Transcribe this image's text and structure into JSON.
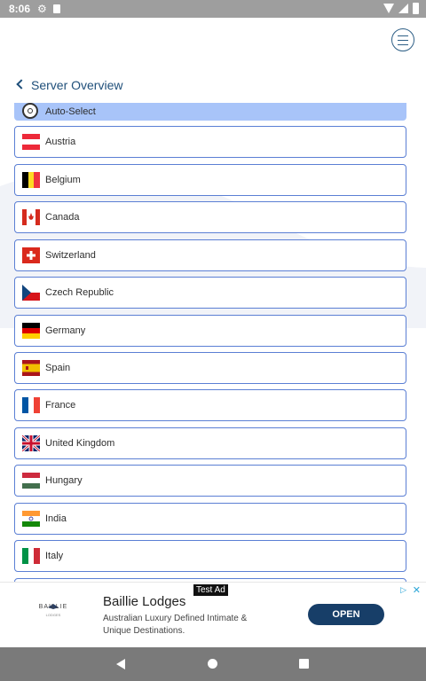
{
  "status_bar": {
    "time": "8:06"
  },
  "header": {
    "title": "Server Overview"
  },
  "servers": [
    {
      "label": "Auto-Select",
      "flag": "auto-select-icon",
      "selected": true
    },
    {
      "label": "Austria",
      "flag": "austria-flag-icon"
    },
    {
      "label": "Belgium",
      "flag": "belgium-flag-icon"
    },
    {
      "label": "Canada",
      "flag": "canada-flag-icon"
    },
    {
      "label": "Switzerland",
      "flag": "switzerland-flag-icon"
    },
    {
      "label": "Czech Republic",
      "flag": "czech-flag-icon"
    },
    {
      "label": "Germany",
      "flag": "germany-flag-icon"
    },
    {
      "label": "Spain",
      "flag": "spain-flag-icon"
    },
    {
      "label": "France",
      "flag": "france-flag-icon"
    },
    {
      "label": "United Kingdom",
      "flag": "uk-flag-icon"
    },
    {
      "label": "Hungary",
      "flag": "hungary-flag-icon"
    },
    {
      "label": "India",
      "flag": "india-flag-icon"
    },
    {
      "label": "Italy",
      "flag": "italy-flag-icon"
    }
  ],
  "ad": {
    "badge": "Test Ad",
    "logo_text": "BAILLIE",
    "logo_sub": "LODGES",
    "title": "Baillie Lodges",
    "description": "Australian Luxury Defined Intimate & Unique Destinations.",
    "cta": "OPEN"
  },
  "colors": {
    "accent": "#1f4f7a",
    "row_border": "#5b7fd4",
    "selected_row": "#a8c4f9",
    "ad_button": "#173e68"
  }
}
